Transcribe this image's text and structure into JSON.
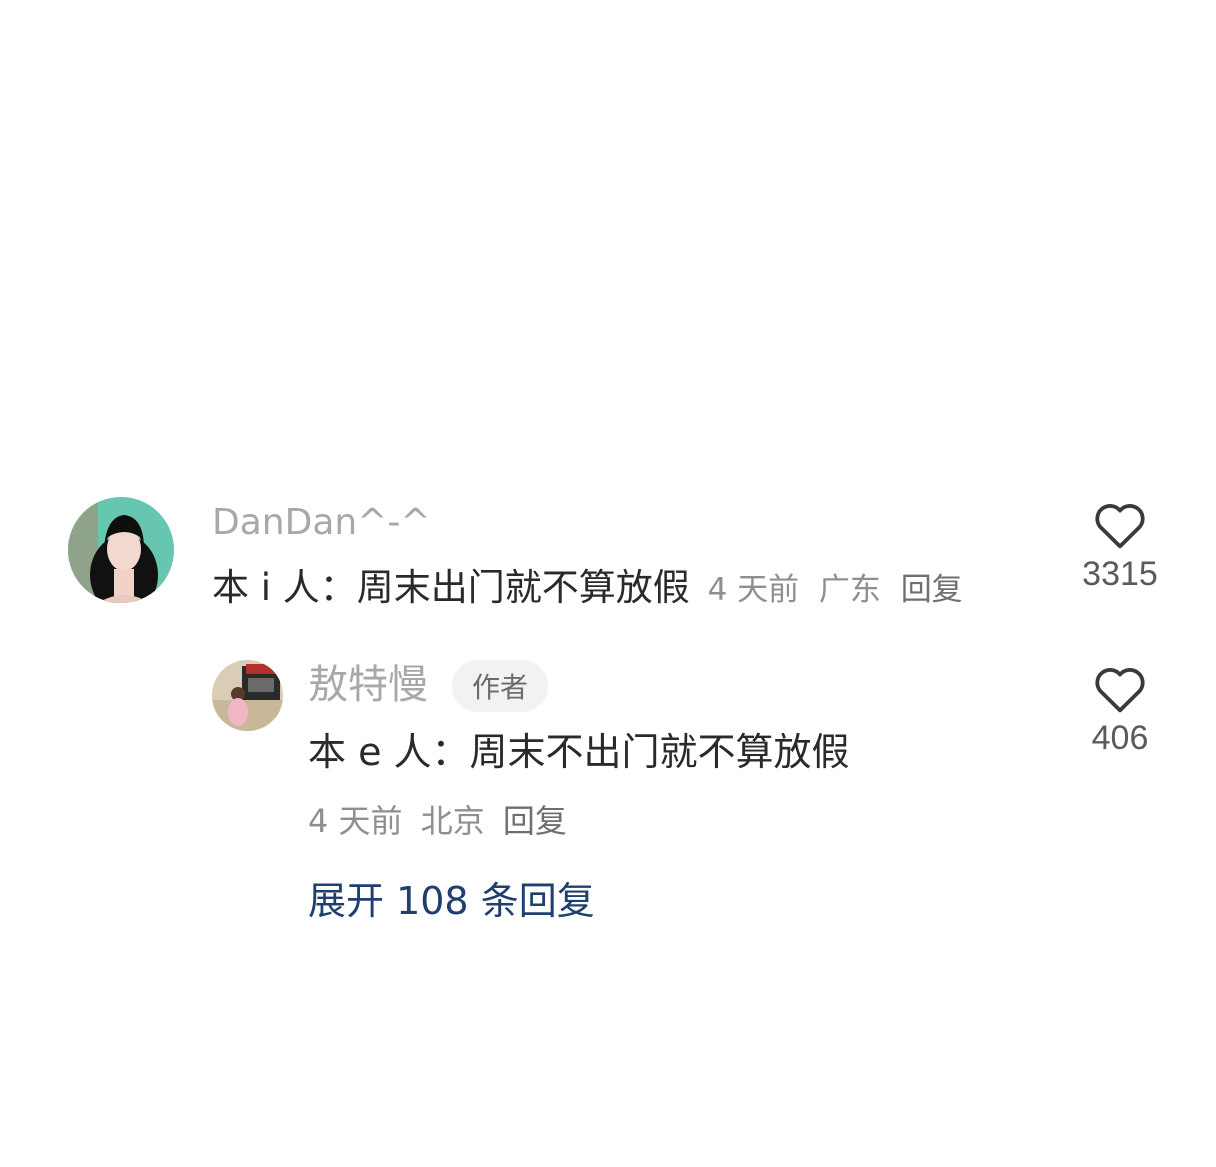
{
  "comment": {
    "username": "DanDan^-^",
    "text": "本 i 人：周末出门就不算放假",
    "time": "4 天前",
    "location": "广东",
    "reply_label": "回复",
    "like_count": "3315",
    "avatar_icon": "user-avatar"
  },
  "reply": {
    "username": "敖特慢",
    "badge": "作者",
    "text": "本 e 人：周末不出门就不算放假",
    "time": "4 天前",
    "location": "北京",
    "reply_label": "回复",
    "like_count": "406",
    "avatar_icon": "user-avatar"
  },
  "expand_label": "展开 108 条回复",
  "icons": {
    "like": "heart-outline-icon"
  },
  "colors": {
    "link": "#1f3f6e",
    "username": "#a8a8a8",
    "meta": "#8f8f8f",
    "text": "#2a2a2a"
  }
}
